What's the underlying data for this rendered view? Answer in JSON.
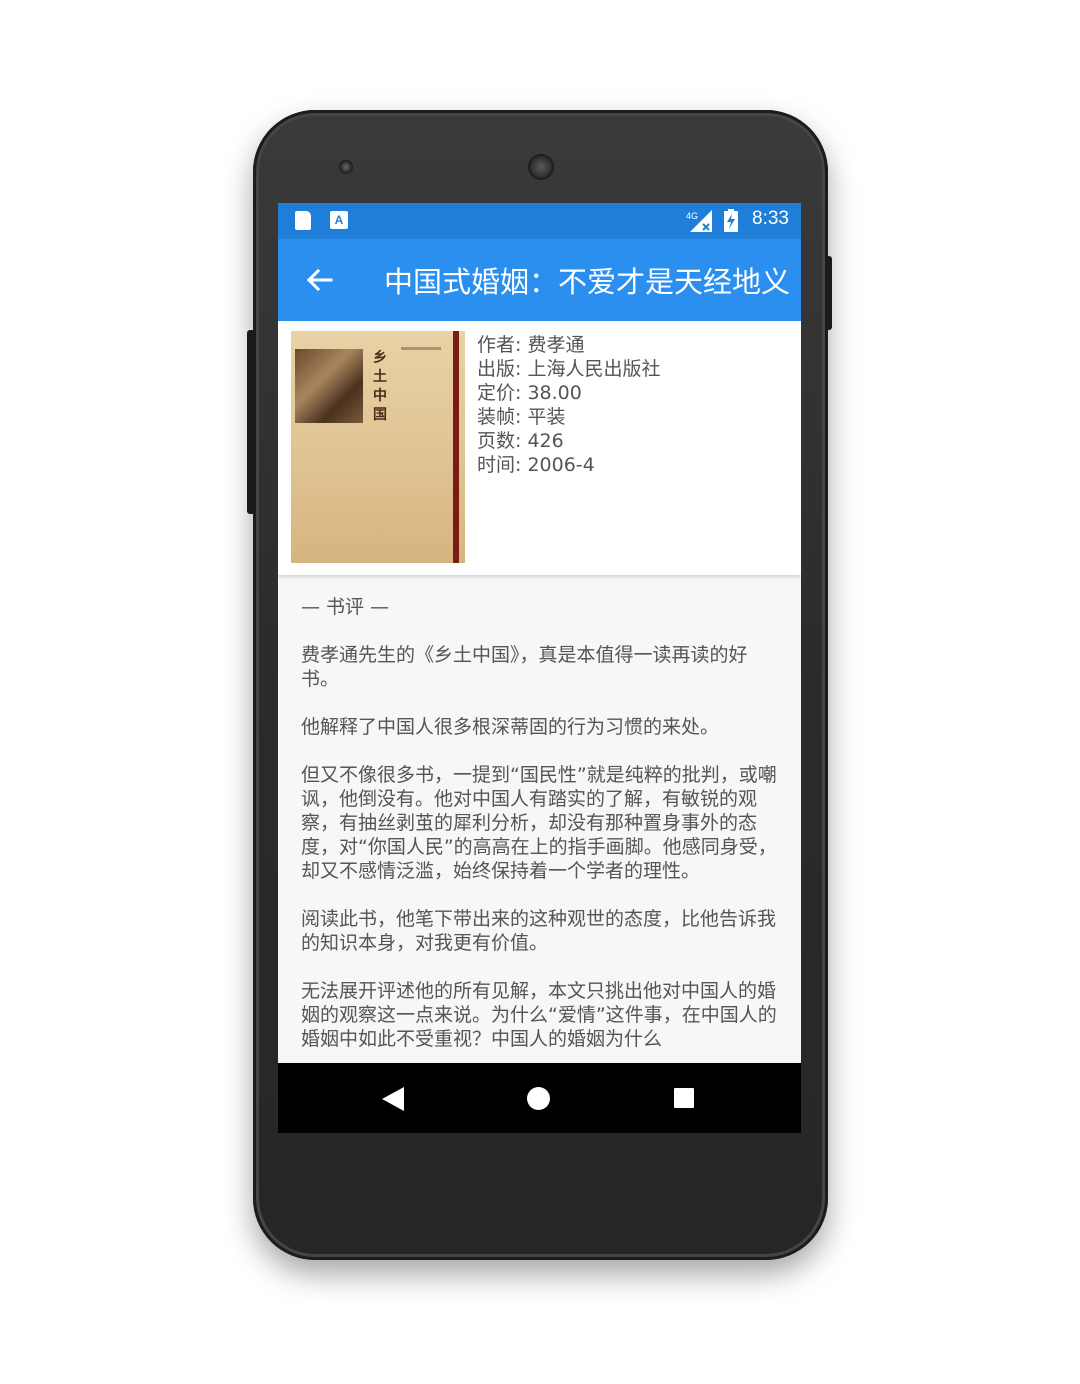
{
  "status_bar": {
    "network": "4G",
    "time": "8:33",
    "icons": [
      "sd-card-icon",
      "a-notification-icon",
      "signal-icon",
      "battery-icon"
    ]
  },
  "app_bar": {
    "title": "中国式婚姻：不爱才是天经地义",
    "back_icon": "arrow-left-icon"
  },
  "book": {
    "cover_title": "乡土中国",
    "author": "作者: 费孝通",
    "publisher": "出版: 上海人民出版社",
    "price": "定价: 38.00",
    "binding": "装帧: 平装",
    "pages": "页数: 426",
    "date": "时间: 2006-4"
  },
  "review": {
    "header": "— 书评 —",
    "paragraphs": [
      "费孝通先生的《乡土中国》，真是本值得一读再读的好书。",
      "他解释了中国人很多根深蒂固的行为习惯的来处。",
      "但又不像很多书，一提到“国民性”就是纯粹的批判，或嘲讽，他倒没有。他对中国人有踏实的了解，有敏锐的观察，有抽丝剥茧的犀利分析，却没有那种置身事外的态度，对“你国人民”的高高在上的指手画脚。他感同身受，却又不感情泛滥，始终保持着一个学者的理性。",
      "阅读此书，他笔下带出来的这种观世的态度，比他告诉我的知识本身，对我更有价值。",
      "无法展开评述他的所有见解，本文只挑出他对中国人的婚姻的观察这一点来说。为什么“爱情”这件事，在中国人的婚姻中如此不受重视？中国人的婚姻为什么"
    ]
  },
  "nav_bar": {
    "buttons": [
      "back-triangle-icon",
      "home-circle-icon",
      "recents-square-icon"
    ]
  },
  "colors": {
    "status_bar": "#1f7ed8",
    "app_bar": "#2b8ff0",
    "text": "#555555",
    "screen_bg": "#f7f7f8"
  }
}
